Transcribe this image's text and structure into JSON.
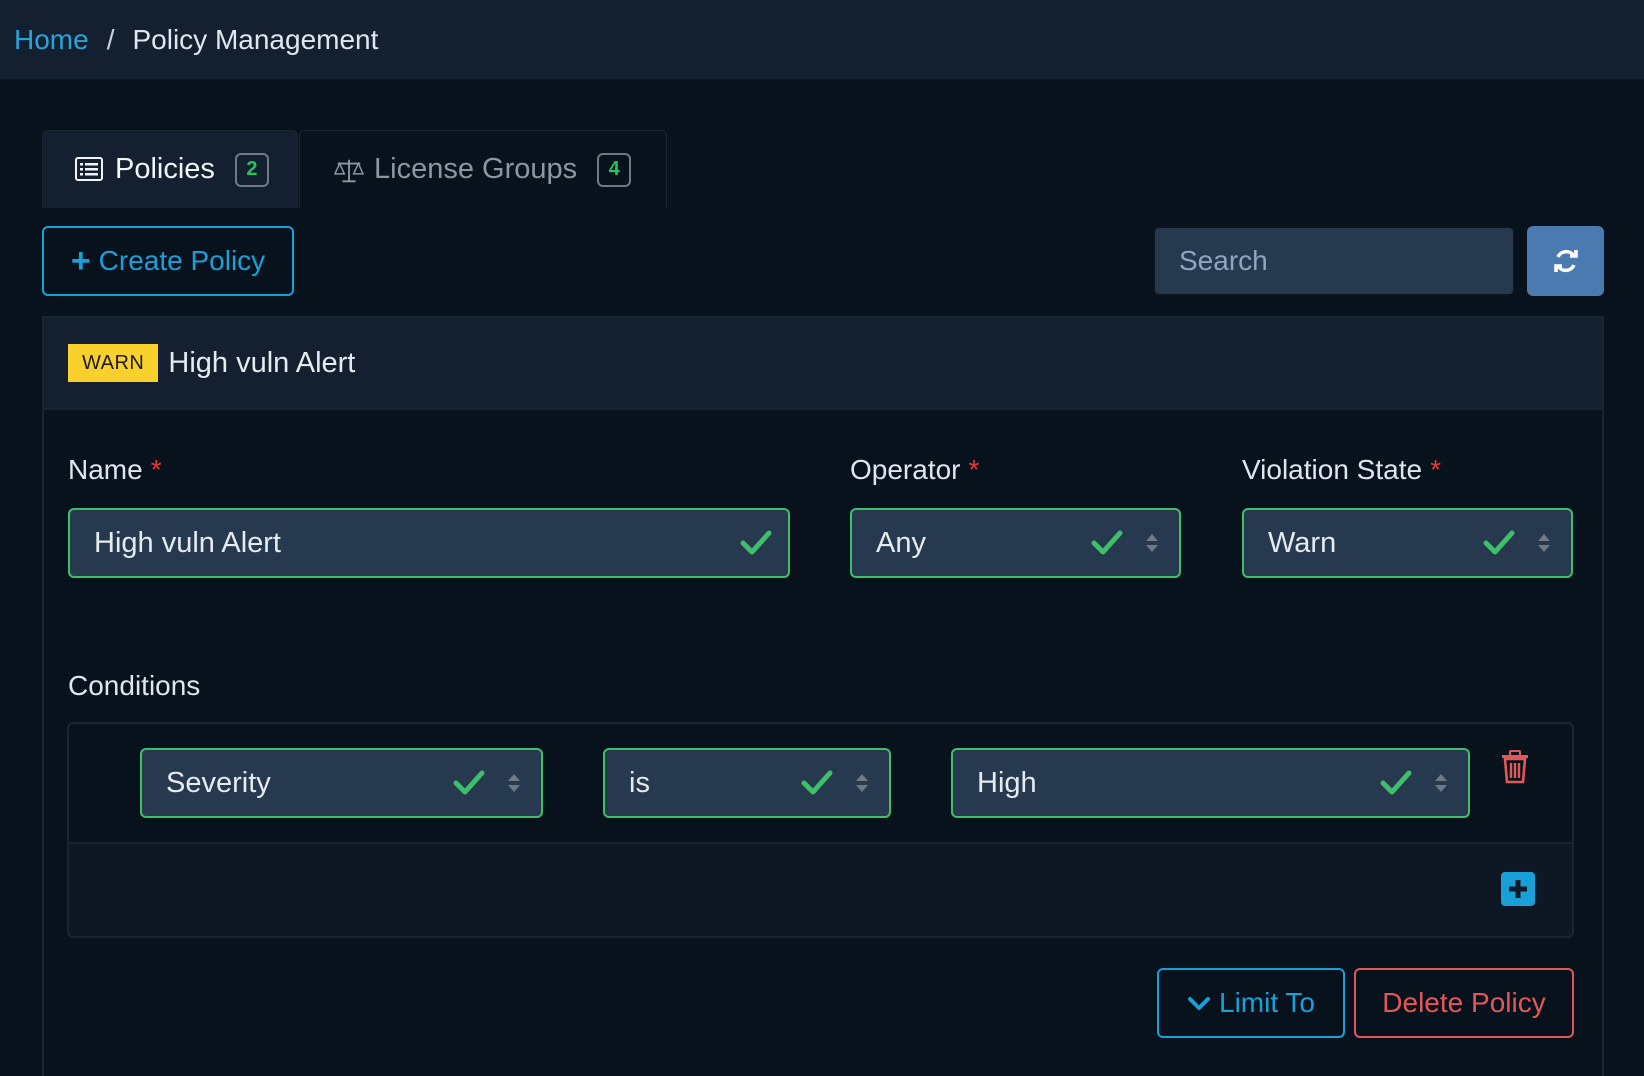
{
  "breadcrumb": {
    "home": "Home",
    "separator": "/",
    "current": "Policy Management"
  },
  "tabs": [
    {
      "label": "Policies",
      "count": "2",
      "icon": "list-icon",
      "active": true
    },
    {
      "label": "License Groups",
      "count": "4",
      "icon": "balance-scale-icon",
      "active": false
    }
  ],
  "toolbar": {
    "create_label": "Create Policy",
    "search_placeholder": "Search",
    "refresh_icon": "refresh-icon"
  },
  "policy": {
    "badge": "WARN",
    "title": "High vuln Alert",
    "name_label": "Name",
    "name_value": "High vuln Alert",
    "operator_label": "Operator",
    "operator_value": "Any",
    "violation_label": "Violation State",
    "violation_value": "Warn",
    "required_marker": "*",
    "conditions_label": "Conditions",
    "conditions": [
      {
        "subject": "Severity",
        "operator": "is",
        "value": "High"
      }
    ],
    "limit_label": "Limit To",
    "delete_label": "Delete Policy"
  },
  "colors": {
    "background": "#08121c",
    "panel": "#142030",
    "accent": "#1aa0d8",
    "valid": "#3fbf6a",
    "warn": "#fad02c",
    "danger": "#e25858"
  }
}
